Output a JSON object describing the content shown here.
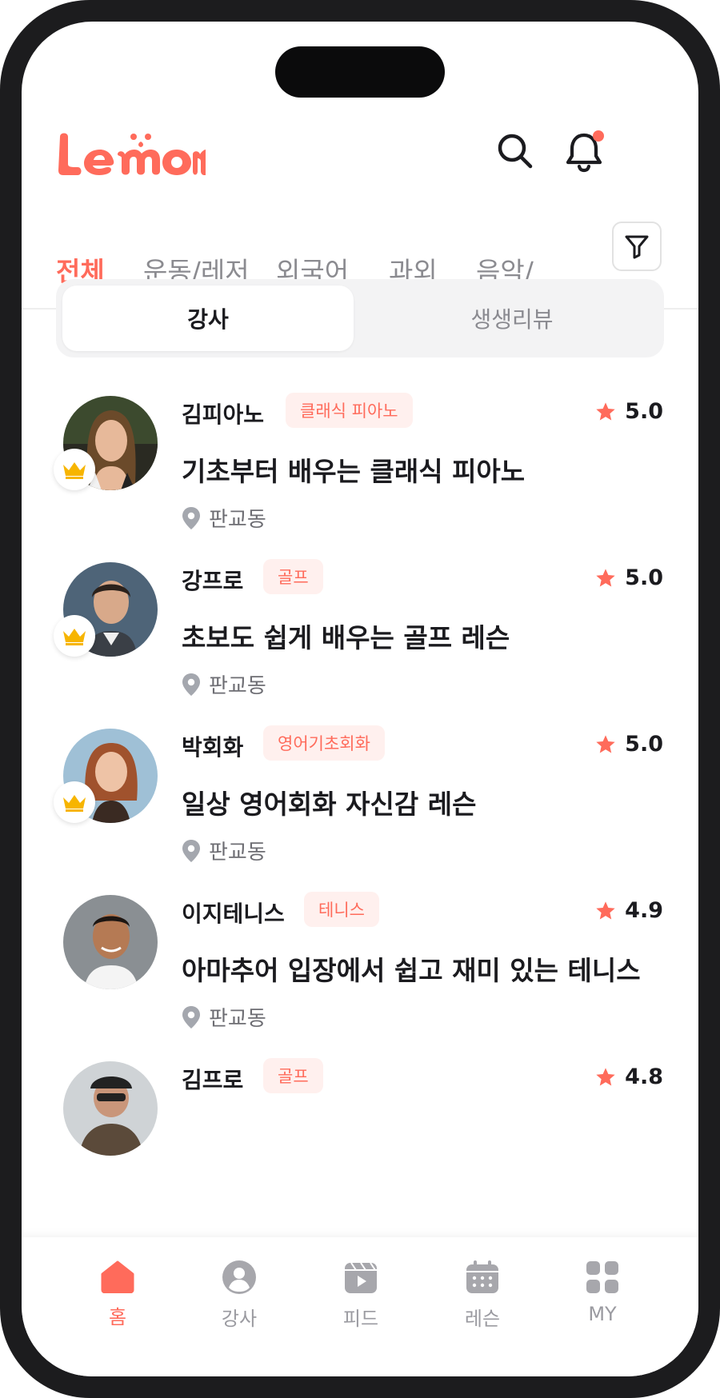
{
  "app": {
    "logo_text": "Lemon"
  },
  "tabs": [
    {
      "label": "전체",
      "active": true
    },
    {
      "label": "운동/레저"
    },
    {
      "label": "외국어"
    },
    {
      "label": "과외"
    },
    {
      "label": "음악/"
    }
  ],
  "segment": {
    "left": "강사",
    "right": "생생리뷰"
  },
  "instructors": [
    {
      "name": "김피아노",
      "tag": "클래식 피아노",
      "rating": "5.0",
      "title": "기초부터 배우는 클래식 피아노",
      "location": "판교동",
      "premium": true
    },
    {
      "name": "강프로",
      "tag": "골프",
      "rating": "5.0",
      "title": "초보도 쉽게 배우는 골프 레슨",
      "location": "판교동",
      "premium": true
    },
    {
      "name": "박회화",
      "tag": "영어기초회화",
      "rating": "5.0",
      "title": "일상 영어회화 자신감 레슨",
      "location": "판교동",
      "premium": true
    },
    {
      "name": "이지테니스",
      "tag": "테니스",
      "rating": "4.9",
      "title": "아마추어 입장에서 쉽고 재미 있는 테니스",
      "location": "판교동",
      "premium": false
    },
    {
      "name": "김프로",
      "tag": "골프",
      "rating": "4.8",
      "title": "",
      "location": "",
      "premium": false
    }
  ],
  "bottom_nav": [
    {
      "label": "홈",
      "icon": "home-icon",
      "active": true
    },
    {
      "label": "강사",
      "icon": "profile-icon"
    },
    {
      "label": "피드",
      "icon": "video-icon"
    },
    {
      "label": "레슨",
      "icon": "calendar-icon"
    },
    {
      "label": "MY",
      "icon": "grid-icon"
    }
  ],
  "colors": {
    "accent": "#ff6b5b",
    "text": "#1b1b1f",
    "muted": "#8b8b90",
    "crown": "#f7b500"
  }
}
